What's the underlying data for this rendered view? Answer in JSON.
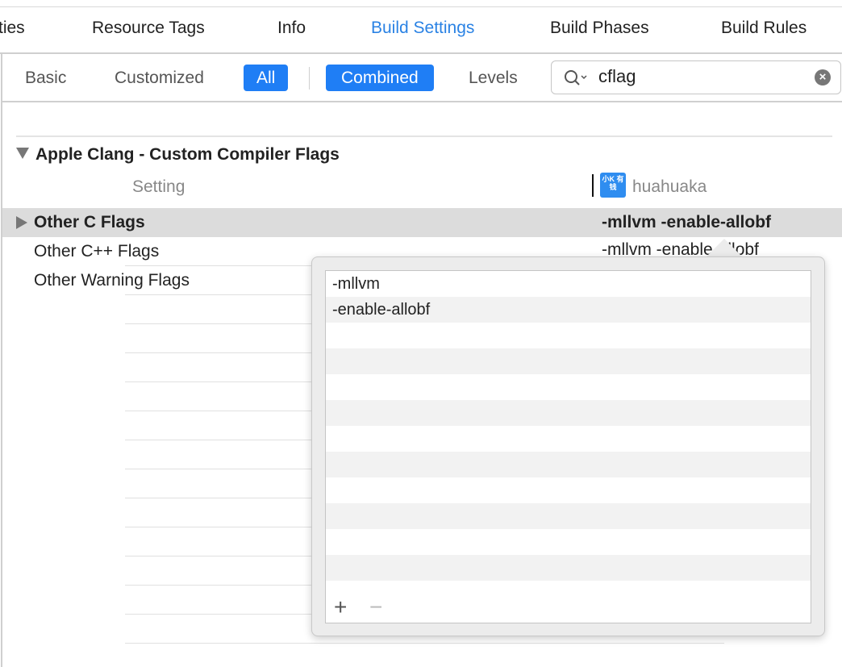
{
  "tabs": [
    "ties",
    "Resource Tags",
    "Info",
    "Build Settings",
    "Build Phases",
    "Build Rules"
  ],
  "filters": {
    "basic": "Basic",
    "customized": "Customized",
    "all": "All",
    "combined": "Combined",
    "levels": "Levels"
  },
  "search": {
    "value": "cflag",
    "clear": "×"
  },
  "section": {
    "title": "Apple Clang - Custom Compiler Flags",
    "col_setting": "Setting",
    "col_target": "huahuaka",
    "icon_text": "小K 有钱"
  },
  "rows": [
    {
      "name": "Other C Flags",
      "value": "-mllvm -enable-allobf"
    },
    {
      "name": "Other C++ Flags",
      "value": "-mllvm -enable-allobf"
    },
    {
      "name": "Other Warning Flags",
      "value": ""
    }
  ],
  "popover": {
    "items": [
      "-mllvm",
      "-enable-allobf"
    ],
    "add": "+",
    "remove": "−"
  }
}
